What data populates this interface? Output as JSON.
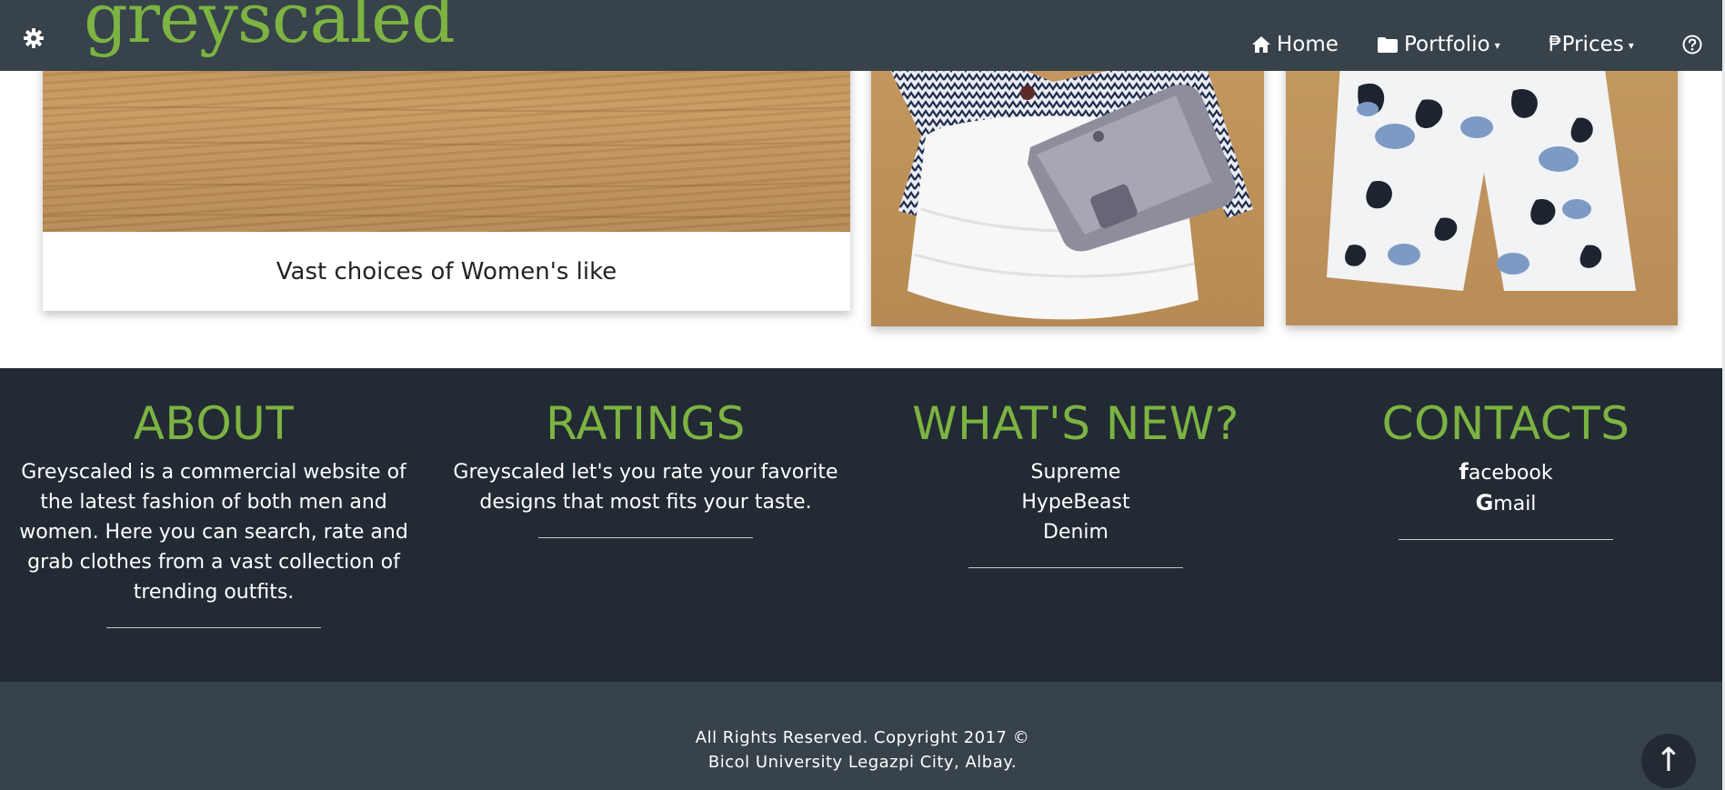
{
  "navbar": {
    "brand": "greyscaled",
    "home_label": "Home",
    "portfolio_label": "Portfolio",
    "prices_label": "Prices",
    "prices_prefix": "₱",
    "caret": "▾",
    "icons": [
      "gear-icon",
      "home-icon",
      "folder-icon",
      "question-circle-icon"
    ]
  },
  "gallery": {
    "card_caption": "Vast choices of Women's like"
  },
  "footer": {
    "about": {
      "title": "ABOUT",
      "text": "Greyscaled is a commercial website of the latest fashion of both men and women. Here you can search, rate and grab clothes from a vast collection of trending outfits."
    },
    "ratings": {
      "title": "RATINGS",
      "text": "Greyscaled let's you rate your favorite designs that most fits your taste."
    },
    "whats_new": {
      "title": "WHAT'S NEW?",
      "items": [
        "Supreme",
        "HypeBeast",
        "Denim"
      ]
    },
    "contacts": {
      "title": "CONTACTS",
      "facebook_initial": "f",
      "facebook_rest": "acebook",
      "gmail_initial": "G",
      "gmail_rest": "mail"
    }
  },
  "bottom": {
    "copyright_line1": "All Rights Reserved. Copyright 2017 ©",
    "copyright_line2": "Bicol University Legazpi City, Albay.",
    "to_top": "↑"
  },
  "colors": {
    "navbar": "#37424a",
    "footer": "#222a33",
    "accent": "#7cb342",
    "text": "#ffffff"
  }
}
